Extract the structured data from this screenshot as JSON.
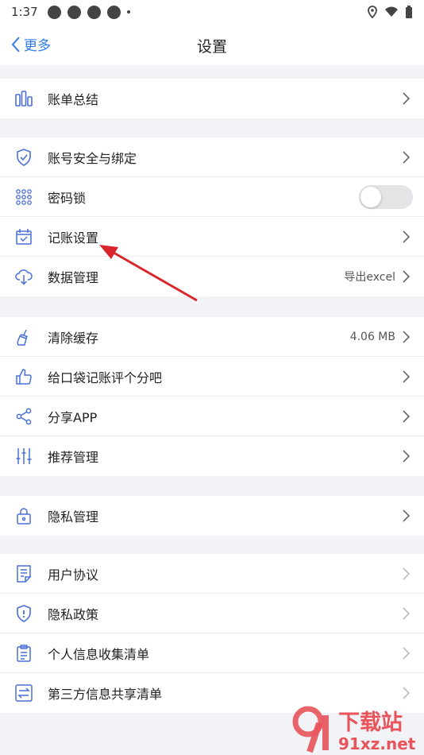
{
  "status_bar": {
    "time": "1:37"
  },
  "nav": {
    "back_label": "更多",
    "title": "设置"
  },
  "groups": [
    {
      "items": [
        {
          "label": "账单总结",
          "icon": "bar-chart-icon"
        }
      ]
    },
    {
      "items": [
        {
          "label": "账号安全与绑定",
          "icon": "shield-check-icon"
        },
        {
          "label": "密码锁",
          "icon": "keypad-icon",
          "toggle": false
        },
        {
          "label": "记账设置",
          "icon": "calendar-check-icon"
        },
        {
          "label": "数据管理",
          "icon": "cloud-download-icon",
          "value": "导出excel"
        }
      ]
    },
    {
      "items": [
        {
          "label": "清除缓存",
          "icon": "broom-icon",
          "value": "4.06 MB"
        },
        {
          "label": "给口袋记账评个分吧",
          "icon": "thumbs-up-icon"
        },
        {
          "label": "分享APP",
          "icon": "share-icon"
        },
        {
          "label": "推荐管理",
          "icon": "sliders-icon"
        }
      ]
    },
    {
      "items": [
        {
          "label": "隐私管理",
          "icon": "lock-icon"
        }
      ]
    },
    {
      "items": [
        {
          "label": "用户协议",
          "icon": "document-icon"
        },
        {
          "label": "隐私政策",
          "icon": "shield-info-icon"
        },
        {
          "label": "个人信息收集清单",
          "icon": "clipboard-icon"
        },
        {
          "label": "第三方信息共享清单",
          "icon": "exchange-icon"
        }
      ]
    }
  ],
  "watermark": {
    "text_cn": "下载站",
    "text_domain": "91xz.net"
  },
  "colors": {
    "accent": "#2f7be8",
    "icon": "#4a6fd6",
    "annotation_arrow": "#d8262c"
  }
}
